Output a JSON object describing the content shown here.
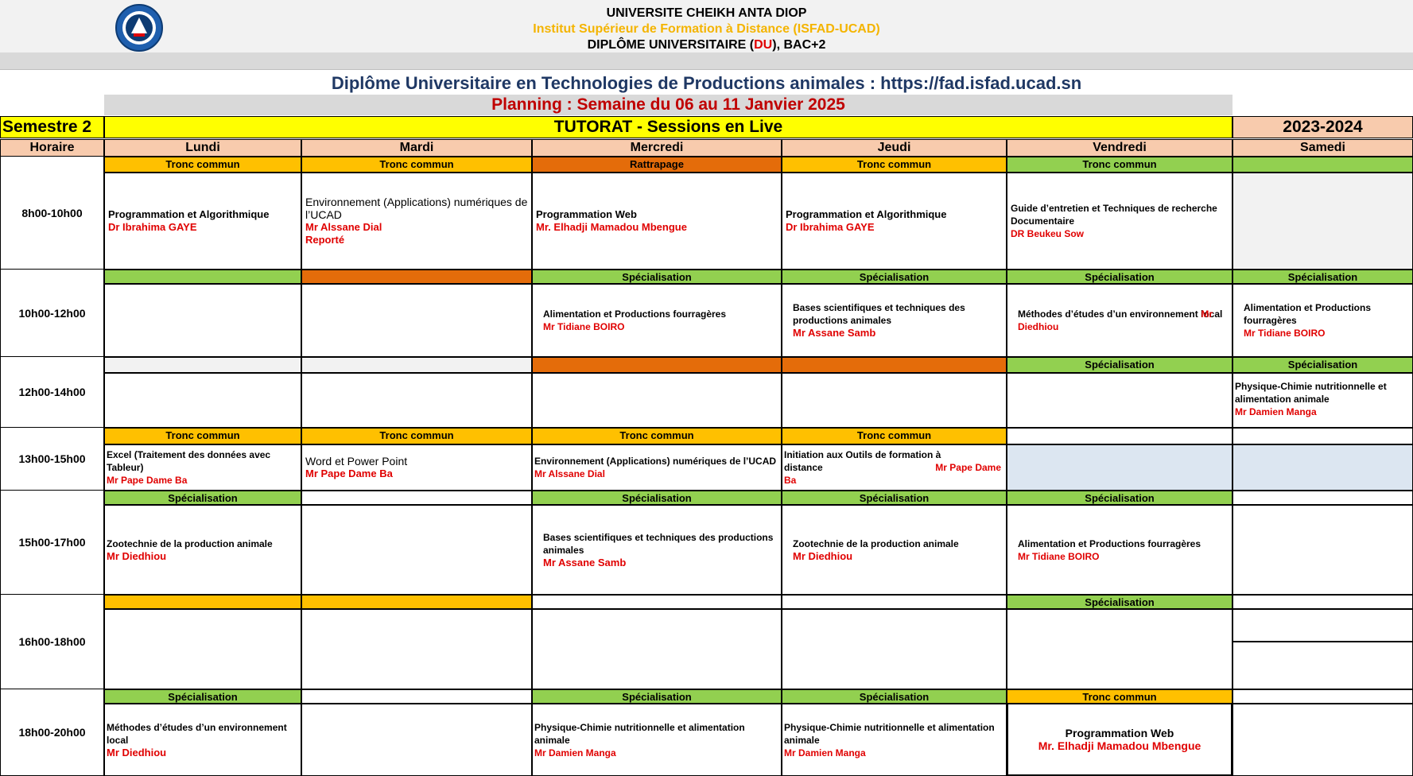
{
  "header": {
    "university": "UNIVERSITE CHEIKH ANTA DIOP",
    "institute": "Institut Supérieur de Formation à Distance (ISFAD-UCAD)",
    "diploma_prefix": "DIPLÔME UNIVERSITAIRE (",
    "diploma_du": "DU",
    "diploma_suffix": "), BAC+2",
    "program_title": "Diplôme Universitaire en Technologies de Productions animales :  https://fad.isfad.ucad.sn",
    "planning": "Planning : Semaine du 06 au 11 Janvier 2025",
    "semester": "Semestre 2",
    "tutorat": "TUTORAT - Sessions en Live",
    "year": "2023-2024"
  },
  "columns": {
    "time": "Horaire",
    "days": [
      "Lundi",
      "Mardi",
      "Mercredi",
      "Jeudi",
      "Vendredi",
      "Samedi"
    ]
  },
  "times": [
    "8h00-10h00",
    "10h00-12h00",
    "12h00-14h00",
    "13h00-15h00",
    "15h00-17h00",
    "16h00-18h00",
    "18h00-20h00"
  ],
  "labels": {
    "tronc": "Tronc commun",
    "spec": "Spécialisation",
    "rattrapage": "Rattrapage"
  },
  "colors": {
    "tronc_strip": "#ffc000",
    "spec_strip": "#92d050",
    "rattrapage_strip": "#e46c0a",
    "teacher_text": "#e00000",
    "planning_text": "#c00000",
    "institute_text": "#f4b400",
    "title_text": "#1f3864"
  },
  "sessions": {
    "r1": {
      "lun": {
        "course": "Programmation et Algorithmique",
        "teacher": "Dr Ibrahima GAYE"
      },
      "mar": {
        "course": "Environnement (Applications) numériques de l’UCAD",
        "teacher": "Mr Alssane Dial",
        "note": "Reporté"
      },
      "mer": {
        "course": "Programmation Web",
        "teacher": "Mr. Elhadji Mamadou Mbengue"
      },
      "jeu": {
        "course": "Programmation et Algorithmique",
        "teacher": "Dr Ibrahima GAYE"
      },
      "ven": {
        "course": "Guide d’entretien et Techniques de recherche Documentaire",
        "teacher": "DR Beukeu Sow"
      }
    },
    "r2": {
      "mer": {
        "course": "Alimentation et Productions fourragères",
        "teacher": "Mr Tidiane BOIRO"
      },
      "jeu": {
        "course": "Bases scientifiques et techniques des productions animales",
        "teacher": "Mr Assane Samb"
      },
      "ven": {
        "course": "Méthodes d’études d’un environnement local",
        "teacher_a": "Mr",
        "teacher_b": "Diedhiou"
      },
      "sam": {
        "course": "Alimentation et Productions fourragères",
        "teacher": "Mr Tidiane BOIRO"
      }
    },
    "r3": {
      "sam": {
        "course": "Physique-Chimie nutritionnelle et alimentation animale",
        "teacher": "Mr Damien Manga"
      }
    },
    "r4": {
      "lun": {
        "course": "Excel (Traitement des données avec Tableur)",
        "teacher": "Mr Pape Dame Ba"
      },
      "mar": {
        "course": "Word et Power Point",
        "teacher": "Mr  Pape Dame Ba"
      },
      "mer": {
        "course": "Environnement (Applications) numériques de l’UCAD",
        "teacher": "Mr Alssane Dial"
      },
      "jeu": {
        "course_a": "Initiation aux Outils de formation à",
        "course_b": "distance",
        "teacher_a": "Mr Pape Dame",
        "teacher_b": "Ba"
      }
    },
    "r5": {
      "lun": {
        "course": "Zootechnie de la production animale",
        "teacher": "Mr Diedhiou"
      },
      "mer": {
        "course": "Bases scientifiques et techniques des productions animales",
        "teacher": "Mr Assane Samb"
      },
      "jeu": {
        "course": "Zootechnie de la production animale",
        "teacher": "Mr Diedhiou"
      },
      "ven": {
        "course": "Alimentation et Productions fourragères",
        "teacher": "Mr Tidiane BOIRO"
      }
    },
    "r7": {
      "lun": {
        "course": "Méthodes d’études d’un environnement local",
        "teacher": "Mr Diedhiou"
      },
      "mer": {
        "course": "Physique-Chimie nutritionnelle et alimentation animale",
        "teacher": "Mr Damien Manga"
      },
      "jeu": {
        "course": "Physique-Chimie nutritionnelle et alimentation animale",
        "teacher": "Mr Damien Manga"
      },
      "ven": {
        "course": "Programmation Web",
        "teacher": "Mr. Elhadji Mamadou Mbengue"
      }
    }
  }
}
